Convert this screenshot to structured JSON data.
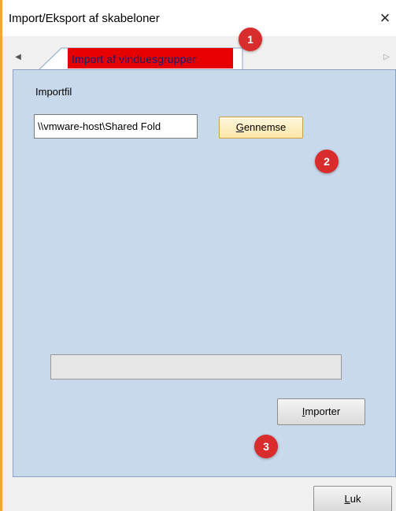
{
  "window": {
    "title": "Import/Eksport af skabeloner",
    "close_glyph": "×",
    "accent_left_border": "#f3a43a"
  },
  "tabs": {
    "scroll_left_glyph": "◀",
    "scroll_right_glyph": "▷",
    "active_label": "Import af vinduesgrupper",
    "highlight_color": "#e60000"
  },
  "form": {
    "import_label": "Importfil",
    "file_value": "\\\\vmware-host\\Shared Fold",
    "browse_label_first": "G",
    "browse_label_rest": "ennemse",
    "import_label_first": "I",
    "import_label_rest": "mporter",
    "close_label_first": "L",
    "close_label_rest": "uk"
  },
  "annotations": {
    "badge_1": "1",
    "badge_2": "2",
    "badge_3": "3",
    "badge_color": "#d92c2c"
  }
}
